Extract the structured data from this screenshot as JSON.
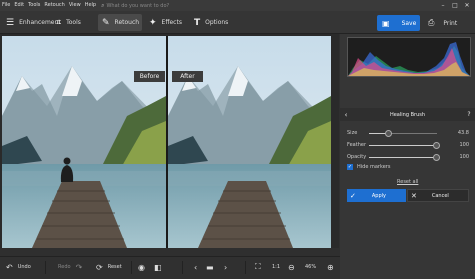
{
  "menu": {
    "items": [
      "File",
      "Edit",
      "Tools",
      "Retouch",
      "View",
      "Help"
    ],
    "search_placeholder": "What do you want to do?",
    "search_icon": "search-icon",
    "window_controls": [
      "–",
      "□",
      "✕"
    ]
  },
  "toolbar": {
    "tabs": [
      {
        "label": "Enhancement",
        "icon": "sliders-icon",
        "glyph": "☰"
      },
      {
        "label": "Tools",
        "icon": "crop-icon",
        "glyph": "⌗"
      },
      {
        "label": "Retouch",
        "icon": "brush-icon",
        "glyph": "✎"
      },
      {
        "label": "Effects",
        "icon": "magic-wand-icon",
        "glyph": "✦"
      },
      {
        "label": "Options",
        "icon": "text-icon",
        "glyph": "T"
      }
    ],
    "active_tab": "Retouch",
    "save_label": "Save",
    "print_label": "Print",
    "accent": "#1e6fd1"
  },
  "canvas": {
    "before_label": "Before",
    "after_label": "After"
  },
  "panel": {
    "title": "Healing Brush",
    "back_glyph": "‹",
    "help_glyph": "?",
    "sliders": [
      {
        "label": "Size",
        "value": "43.8",
        "level": 0.3
      },
      {
        "label": "Feather",
        "value": "100",
        "level": 1.0
      },
      {
        "label": "Opacity",
        "value": "100",
        "level": 1.0
      }
    ],
    "hide_markers_label": "Hide markers",
    "hide_markers_checked": true,
    "reset_all_label": "Reset all",
    "apply_label": "Apply",
    "cancel_label": "Cancel"
  },
  "bottom": {
    "undo_label": "Undo",
    "redo_label": "Redo",
    "reset_label": "Reset",
    "zoom_fit_label": "1:1",
    "zoom_value": "46%"
  }
}
